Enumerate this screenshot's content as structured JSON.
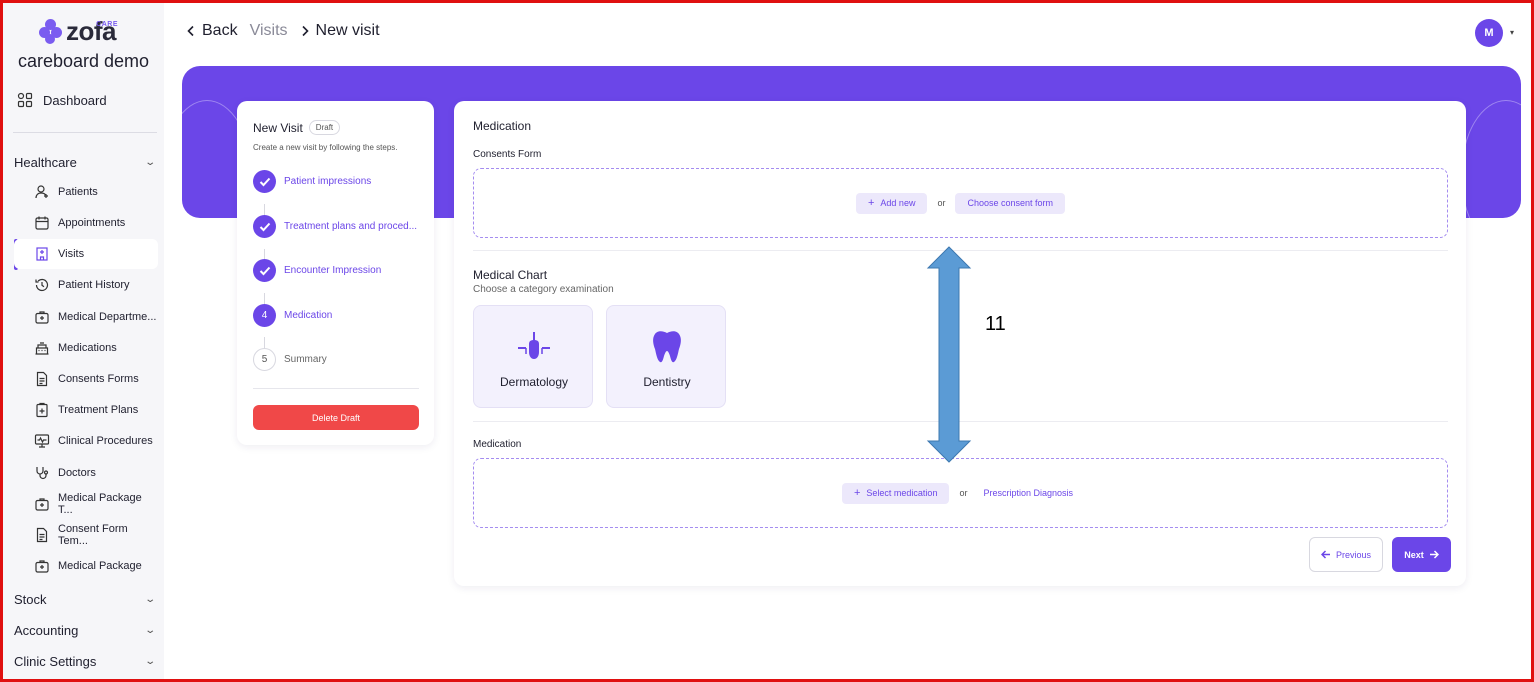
{
  "app": {
    "logo_text": "zofa",
    "logo_care": "CARE",
    "org_name": "careboard demo"
  },
  "sidebar": {
    "dashboard": "Dashboard",
    "healthcare": "Healthcare",
    "items": [
      {
        "label": "Patients",
        "icon": "patient-icon"
      },
      {
        "label": "Appointments",
        "icon": "calendar-icon"
      },
      {
        "label": "Visits",
        "icon": "hospital-icon"
      },
      {
        "label": "Patient History",
        "icon": "history-icon"
      },
      {
        "label": "Medical Departme...",
        "icon": "medical-bag-icon"
      },
      {
        "label": "Medications",
        "icon": "pharmacy-icon"
      },
      {
        "label": "Consents Forms",
        "icon": "document-icon"
      },
      {
        "label": "Treatment Plans",
        "icon": "clipboard-icon"
      },
      {
        "label": "Clinical Procedures",
        "icon": "monitor-icon"
      },
      {
        "label": "Doctors",
        "icon": "stethoscope-icon"
      },
      {
        "label": "Medical Package T...",
        "icon": "medical-bag-icon"
      },
      {
        "label": "Consent Form Tem...",
        "icon": "document-icon"
      },
      {
        "label": "Medical Package",
        "icon": "medical-bag-icon"
      }
    ],
    "active_item": "Visits",
    "groups": [
      "Stock",
      "Accounting",
      "Clinic Settings"
    ]
  },
  "header": {
    "back": "Back",
    "crumb": "Visits",
    "current": "New visit",
    "avatar_initial": "M"
  },
  "steps": {
    "title": "New Visit",
    "badge": "Draft",
    "subtitle": "Create a new visit by following the steps.",
    "list": [
      {
        "label": "Patient impressions",
        "state": "done",
        "num": ""
      },
      {
        "label": "Treatment plans and proced...",
        "state": "done",
        "num": ""
      },
      {
        "label": "Encounter Impression",
        "state": "done",
        "num": ""
      },
      {
        "label": "Medication",
        "state": "current",
        "num": "4"
      },
      {
        "label": "Summary",
        "state": "todo",
        "num": "5"
      }
    ],
    "delete_label": "Delete Draft"
  },
  "main": {
    "title": "Medication",
    "consents": {
      "label": "Consents Form",
      "add_new": "Add new",
      "or": "or",
      "choose": "Choose consent form"
    },
    "chart": {
      "title": "Medical Chart",
      "subtitle": "Choose a category examination",
      "categories": [
        {
          "label": "Dermatology",
          "icon": "hair-follicle-icon"
        },
        {
          "label": "Dentistry",
          "icon": "tooth-icon"
        }
      ]
    },
    "medication": {
      "label": "Medication",
      "select": "Select medication",
      "or": "or",
      "prescription": "Prescription Diagnosis"
    },
    "previous": "Previous",
    "next": "Next"
  },
  "annotation": {
    "label": "11"
  },
  "colors": {
    "accent": "#6b46e8",
    "danger": "#f04848",
    "annotation_arrow": "#5b9bd5",
    "frame": "#e01010"
  }
}
